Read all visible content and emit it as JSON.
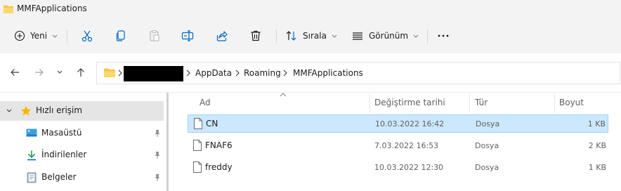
{
  "window": {
    "title": "MMFApplications"
  },
  "toolbar": {
    "new_label": "Yeni",
    "sort_label": "Sırala",
    "view_label": "Görünüm",
    "icons": [
      "add-circle-icon",
      "cut-icon",
      "copy-icon",
      "paste-icon",
      "rename-icon",
      "share-icon",
      "delete-icon",
      "sort-icon",
      "view-icon",
      "more-icon"
    ]
  },
  "address": {
    "crumbs": [
      "AppData",
      "Roaming",
      "MMFApplications"
    ]
  },
  "nav": {
    "items": [
      {
        "label": "Hızlı erişim",
        "icon": "star-icon"
      },
      {
        "label": "Masaüstü",
        "icon": "desktop-icon"
      },
      {
        "label": "İndirilenler",
        "icon": "download-icon"
      },
      {
        "label": "Belgeler",
        "icon": "documents-icon"
      }
    ]
  },
  "files": {
    "columns": [
      "Ad",
      "Değiştirme tarihi",
      "Tür",
      "Boyut"
    ],
    "rows": [
      {
        "name": "CN",
        "date": "10.03.2022 16:42",
        "type": "Dosya",
        "size": "1 KB",
        "selected": true
      },
      {
        "name": "FNAF6",
        "date": "7.03.2022 16:53",
        "type": "Dosya",
        "size": "2 KB",
        "selected": false
      },
      {
        "name": "freddy",
        "date": "10.03.2022 12:30",
        "type": "Dosya",
        "size": "1 KB",
        "selected": false
      }
    ]
  },
  "colors": {
    "accent": "#0067c0",
    "folder": "#f8c544",
    "selection": "#cce8ff",
    "selection_border": "#99d1ff"
  }
}
